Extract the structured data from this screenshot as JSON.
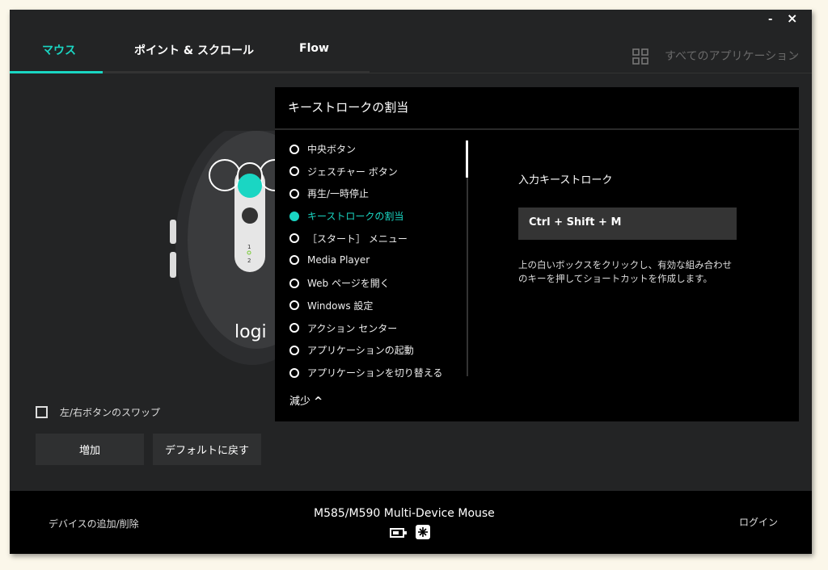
{
  "window": {
    "minimize": "-",
    "close": "×"
  },
  "tabs": [
    {
      "label": "マウス",
      "active": true
    },
    {
      "label": "ポイント & スクロール"
    },
    {
      "label": "Flow"
    }
  ],
  "app_selector": {
    "label": "すべてのアプリケーション",
    "icon": "grid-icon"
  },
  "accent": "#1ad6c3",
  "mouse": {
    "logo": "logi",
    "channels": [
      "1",
      "2"
    ]
  },
  "swap_checkbox": {
    "label": "左/右ボタンのスワップ",
    "checked": false
  },
  "buttons": {
    "add": "増加",
    "reset": "デフォルトに戻す"
  },
  "panel": {
    "title": "キーストロークの割当",
    "items": [
      "中央ボタン",
      "ジェスチャー ボタン",
      "再生/一時停止",
      "キーストロークの割当",
      "［スタート］ メニュー",
      "Media Player",
      "Web ページを開く",
      "Windows 設定",
      "アクション センター",
      "アプリケーションの起動",
      "アプリケーションを切り替える"
    ],
    "selected_index": 3,
    "collapse_label": "減少",
    "input_label": "入力キーストローク",
    "keystroke": "Ctrl + Shift + M",
    "help": "上の白いボックスをクリックし、有効な組み合わせのキーを押してショートカットを作成します。"
  },
  "footer": {
    "add_remove": "デバイスの追加/削除",
    "device": "M585/M590 Multi-Device Mouse",
    "login": "ログイン"
  }
}
